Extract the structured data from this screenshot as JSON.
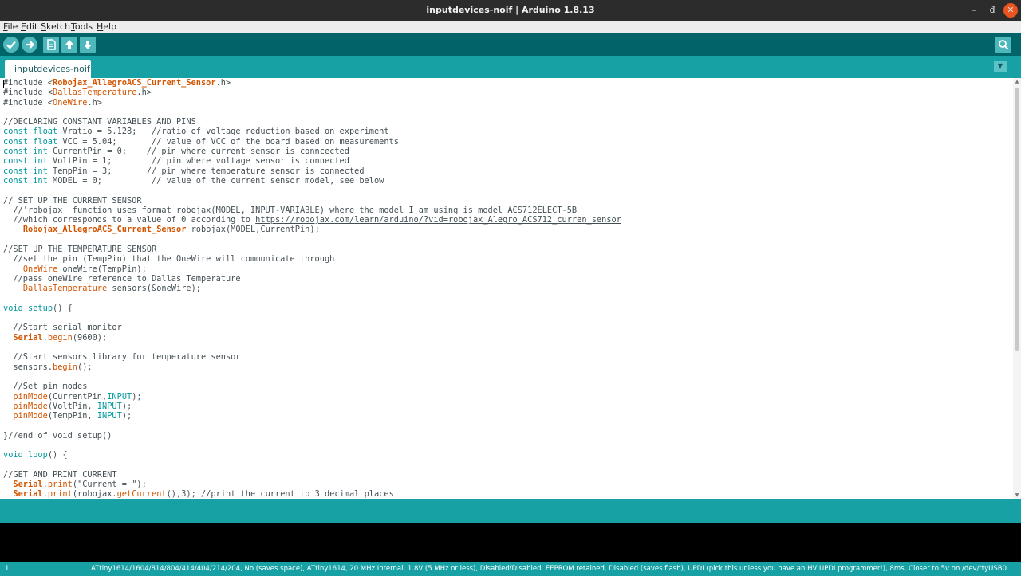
{
  "window": {
    "title": "inputdevices-noif | Arduino 1.8.13",
    "minimize_icon": "–",
    "maximize_icon": "đ",
    "close_icon": "✕"
  },
  "menu": {
    "items": [
      {
        "accel": "F",
        "rest": "ile"
      },
      {
        "accel": "E",
        "rest": "dit"
      },
      {
        "accel": "S",
        "rest": "ketch"
      },
      {
        "accel": "T",
        "rest": "ools"
      },
      {
        "accel": "H",
        "rest": "elp"
      }
    ]
  },
  "toolbar": {
    "icons": [
      "verify-icon",
      "upload-icon",
      "new-icon",
      "open-icon",
      "save-icon",
      "serial-monitor-icon"
    ],
    "accent": "#006468"
  },
  "tabs": [
    {
      "label": "inputdevices-noif"
    }
  ],
  "tab_menu_icon": "▼",
  "code_lines": [
    [
      {
        "t": "#include <",
        "c": ""
      },
      {
        "t": "Robojax_AllegroACS_Current_Sensor",
        "c": "libb"
      },
      {
        "t": ".h>",
        "c": ""
      }
    ],
    [
      {
        "t": "#include <",
        "c": ""
      },
      {
        "t": "DallasTemperature",
        "c": "lib"
      },
      {
        "t": ".h>",
        "c": ""
      }
    ],
    [
      {
        "t": "#include <",
        "c": ""
      },
      {
        "t": "OneWire",
        "c": "lib"
      },
      {
        "t": ".h>",
        "c": ""
      }
    ],
    [],
    [
      {
        "t": "//DECLARING CONSTANT VARIABLES AND PINS",
        "c": "cm"
      }
    ],
    [
      {
        "t": "const float",
        "c": "kw"
      },
      {
        "t": " Vratio = 5.128;   //ratio of voltage reduction based on experiment",
        "c": ""
      }
    ],
    [
      {
        "t": "const float",
        "c": "kw"
      },
      {
        "t": " VCC = 5.04;       // value of VCC of the board based on measurements",
        "c": ""
      }
    ],
    [
      {
        "t": "const int",
        "c": "kw"
      },
      {
        "t": " CurrentPin = 0;    // pin where current sensor is conncected",
        "c": ""
      }
    ],
    [
      {
        "t": "const int",
        "c": "kw"
      },
      {
        "t": " VoltPin = 1;        // pin where voltage sensor is connected",
        "c": ""
      }
    ],
    [
      {
        "t": "const int",
        "c": "kw"
      },
      {
        "t": " TempPin = 3;       // pin where temperature sensor is connected",
        "c": ""
      }
    ],
    [
      {
        "t": "const int",
        "c": "kw"
      },
      {
        "t": " MODEL = 0;          // value of the current sensor model, see below",
        "c": ""
      }
    ],
    [],
    [
      {
        "t": "// SET UP THE CURRENT SENSOR",
        "c": "cm"
      }
    ],
    [
      {
        "t": "  //'robojax' function uses format robojax(MODEL, INPUT-VARIABLE) where the model I am using is model ACS712ELECT-5B",
        "c": "cm"
      }
    ],
    [
      {
        "t": "  //which corresponds to a value of 0 according to ",
        "c": "cm"
      },
      {
        "t": "https://robojax.com/learn/arduino/?vid=robojax_Alegro_ACS712_curren_sensor",
        "c": "lnk"
      }
    ],
    [
      {
        "t": "    ",
        "c": ""
      },
      {
        "t": "Robojax_AllegroACS_Current_Sensor",
        "c": "libb"
      },
      {
        "t": " robojax(MODEL,CurrentPin);",
        "c": ""
      }
    ],
    [],
    [
      {
        "t": "//SET UP THE TEMPERATURE SENSOR",
        "c": "cm"
      }
    ],
    [
      {
        "t": "  //set the pin (TempPin) that the OneWire will communicate through",
        "c": "cm"
      }
    ],
    [
      {
        "t": "    ",
        "c": ""
      },
      {
        "t": "OneWire",
        "c": "lib"
      },
      {
        "t": " oneWire(TempPin);",
        "c": ""
      }
    ],
    [
      {
        "t": "  //pass oneWire reference to Dallas Temperature",
        "c": "cm"
      }
    ],
    [
      {
        "t": "    ",
        "c": ""
      },
      {
        "t": "DallasTemperature",
        "c": "lib"
      },
      {
        "t": " sensors(&oneWire);",
        "c": ""
      }
    ],
    [],
    [
      {
        "t": "void",
        "c": "kw"
      },
      {
        "t": " ",
        "c": ""
      },
      {
        "t": "setup",
        "c": "kw"
      },
      {
        "t": "() {",
        "c": ""
      }
    ],
    [],
    [
      {
        "t": "  //Start serial monitor",
        "c": "cm"
      }
    ],
    [
      {
        "t": "  ",
        "c": ""
      },
      {
        "t": "Serial",
        "c": "libb"
      },
      {
        "t": ".",
        "c": ""
      },
      {
        "t": "begin",
        "c": "fn"
      },
      {
        "t": "(9600);",
        "c": ""
      }
    ],
    [],
    [
      {
        "t": "  //Start sensors library for temperature sensor",
        "c": "cm"
      }
    ],
    [
      {
        "t": "  sensors.",
        "c": ""
      },
      {
        "t": "begin",
        "c": "fn"
      },
      {
        "t": "();",
        "c": ""
      }
    ],
    [],
    [
      {
        "t": "  //Set pin modes",
        "c": "cm"
      }
    ],
    [
      {
        "t": "  ",
        "c": ""
      },
      {
        "t": "pinMode",
        "c": "fn"
      },
      {
        "t": "(CurrentPin,",
        "c": ""
      },
      {
        "t": "INPUT",
        "c": "kw"
      },
      {
        "t": ");",
        "c": ""
      }
    ],
    [
      {
        "t": "  ",
        "c": ""
      },
      {
        "t": "pinMode",
        "c": "fn"
      },
      {
        "t": "(VoltPin, ",
        "c": ""
      },
      {
        "t": "INPUT",
        "c": "kw"
      },
      {
        "t": ");",
        "c": ""
      }
    ],
    [
      {
        "t": "  ",
        "c": ""
      },
      {
        "t": "pinMode",
        "c": "fn"
      },
      {
        "t": "(TempPin, ",
        "c": ""
      },
      {
        "t": "INPUT",
        "c": "kw"
      },
      {
        "t": ");",
        "c": ""
      }
    ],
    [],
    [
      {
        "t": "}//end of void setup()",
        "c": ""
      }
    ],
    [],
    [
      {
        "t": "void",
        "c": "kw"
      },
      {
        "t": " ",
        "c": ""
      },
      {
        "t": "loop",
        "c": "kw"
      },
      {
        "t": "() {",
        "c": ""
      }
    ],
    [],
    [
      {
        "t": "//GET AND PRINT CURRENT",
        "c": "cm"
      }
    ],
    [
      {
        "t": "  ",
        "c": ""
      },
      {
        "t": "Serial",
        "c": "libb"
      },
      {
        "t": ".",
        "c": ""
      },
      {
        "t": "print",
        "c": "fn"
      },
      {
        "t": "(\"Current = \");",
        "c": ""
      }
    ],
    [
      {
        "t": "  ",
        "c": ""
      },
      {
        "t": "Serial",
        "c": "libb"
      },
      {
        "t": ".",
        "c": ""
      },
      {
        "t": "print",
        "c": "fn"
      },
      {
        "t": "(robojax.",
        "c": ""
      },
      {
        "t": "getCurrent",
        "c": "fn"
      },
      {
        "t": "(),3); //print the current to 3 decimal places",
        "c": ""
      }
    ]
  ],
  "footer": {
    "line_number": "1",
    "board_info": "ATtiny1614/1604/814/804/414/404/214/204, No (saves space), ATtiny1614, 20 MHz Internal, 1.8V (5 MHz or less), Disabled/Disabled, EEPROM retained, Disabled (saves flash), UPDI (pick this unless you have an HV UPDI programmer!), 8ms, Closer to 5v on /dev/ttyUSB0"
  }
}
